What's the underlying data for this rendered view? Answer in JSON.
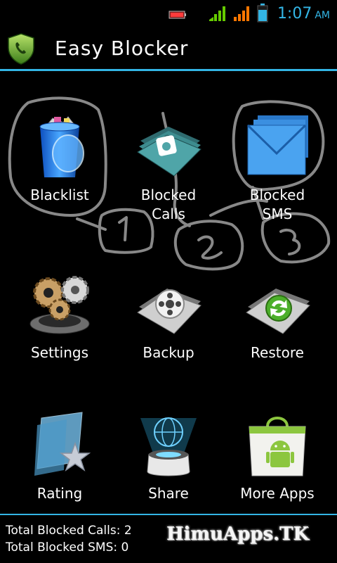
{
  "status_bar": {
    "time": "1:07",
    "ampm": "AM",
    "icons": [
      "battery-notification-icon",
      "signal-strength-icon",
      "signal-strength-2-icon",
      "battery-icon"
    ],
    "colors": {
      "accent": "#33b5e5",
      "signal1": "#66cc00",
      "signal2": "#ff7700"
    }
  },
  "app": {
    "title": "Easy Blocker",
    "icon": "shield-phone-icon"
  },
  "grid": {
    "items": [
      {
        "label": "Blacklist",
        "icon": "recycle-bin-icon"
      },
      {
        "label": "Blocked\nCalls",
        "icon": "phone-folder-icon"
      },
      {
        "label": "Blocked\nSMS",
        "icon": "envelope-folder-icon"
      },
      {
        "label": "Settings",
        "icon": "gears-icon"
      },
      {
        "label": "Backup",
        "icon": "film-reel-icon"
      },
      {
        "label": "Restore",
        "icon": "refresh-icon"
      },
      {
        "label": "Rating",
        "icon": "star-card-icon"
      },
      {
        "label": "Share",
        "icon": "globe-hologram-icon"
      },
      {
        "label": "More Apps",
        "icon": "shopping-bag-android-icon"
      }
    ]
  },
  "footer": {
    "blocked_calls": "Total Blocked Calls: 2",
    "blocked_sms": "Total Blocked SMS: 0",
    "brand": "HimuApps.TK"
  }
}
